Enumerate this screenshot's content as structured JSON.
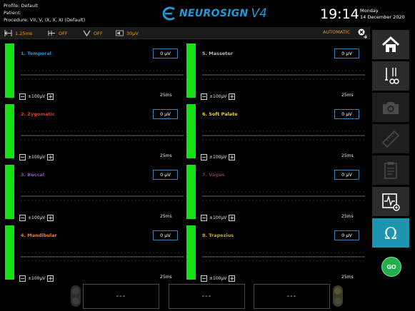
{
  "header": {
    "profile": "Profile: Default",
    "patient": "Patient:",
    "procedure": "Procedure: VII, V, IX, X, XI (Default)",
    "logo_text": "NEUROSIGN",
    "logo_version": "V4",
    "time": "19:14",
    "day": "Monday",
    "date": "14 December 2020"
  },
  "toolbar": {
    "timebase": "1.25ms",
    "filter1": "OFF",
    "filter2": "OFF",
    "threshold": "30µV",
    "mode": "AUTOMATIC"
  },
  "channels": [
    {
      "title": "1. Temporal",
      "color": "#2a8fd6",
      "value": "0 µV",
      "range": "±100µV",
      "time": "25ms"
    },
    {
      "title": "2. Zygomatic",
      "color": "#e03a2a",
      "value": "0 µV",
      "range": "±100µV",
      "time": "25ms"
    },
    {
      "title": "3. Buccal",
      "color": "#8a4fb0",
      "value": "0 µV",
      "range": "±100µV",
      "time": "25ms"
    },
    {
      "title": "4. Mandibular",
      "color": "#f07f1e",
      "value": "0 µV",
      "range": "±100µV",
      "time": "25ms"
    },
    {
      "title": "5. Masseter",
      "color": "#b7b7b7",
      "value": "0 µV",
      "range": "±100µV",
      "time": "25ms"
    },
    {
      "title": "6. Soft Palate",
      "color": "#f2d21a",
      "value": "0 µV",
      "range": "±100µV",
      "time": "25ms"
    },
    {
      "title": "7. Vagus",
      "color": "#7a3b3b",
      "value": "0 µV",
      "range": "±100µV",
      "time": "25ms"
    },
    {
      "title": "8. Trapezius",
      "color": "#c9a63a",
      "value": "0 µV",
      "range": "±100µV",
      "time": "25ms"
    }
  ],
  "sidebar": {
    "go_label": "GO",
    "accent": "#1e95b0",
    "icons": [
      "home-icon",
      "instruments-icon",
      "camera-icon",
      "ruler-icon",
      "clipboard-icon",
      "waveform-settings-icon",
      "omega-icon"
    ]
  },
  "bottom": {
    "box1": "---",
    "box2": "---",
    "box3": "---"
  }
}
